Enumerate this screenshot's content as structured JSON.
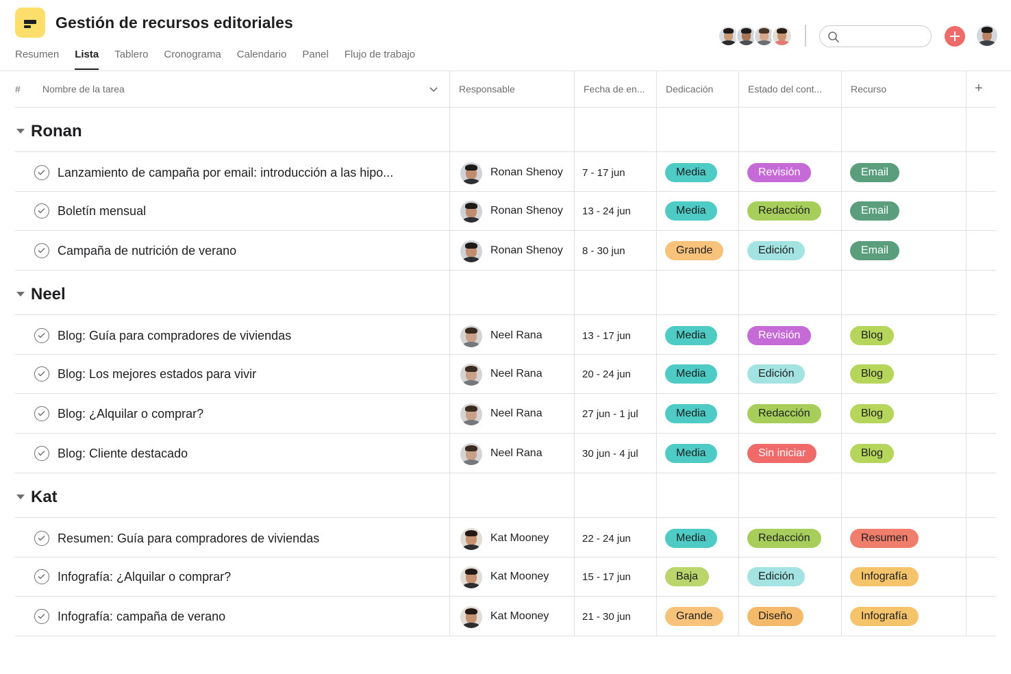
{
  "project": {
    "title": "Gestión de recursos editoriales"
  },
  "tabs": [
    {
      "label": "Resumen",
      "active": false
    },
    {
      "label": "Lista",
      "active": true
    },
    {
      "label": "Tablero",
      "active": false
    },
    {
      "label": "Cronograma",
      "active": false
    },
    {
      "label": "Calendario",
      "active": false
    },
    {
      "label": "Panel",
      "active": false
    },
    {
      "label": "Flujo de trabajo",
      "active": false
    }
  ],
  "columns": {
    "number": "#",
    "task": "Nombre de la tarea",
    "assignee": "Responsable",
    "due": "Fecha de en...",
    "effort": "Dedicación",
    "status": "Estado del cont...",
    "resource": "Recurso",
    "add": "+"
  },
  "colors": {
    "Media": {
      "bg": "#4ecbc4",
      "fg": "#1e1f21"
    },
    "Grande": {
      "bg": "#f8c27a",
      "fg": "#1e1f21"
    },
    "Baja": {
      "bg": "#b9d56b",
      "fg": "#1e1f21"
    },
    "Revisión": {
      "bg": "#c56ad6",
      "fg": "#ffffff"
    },
    "Redacción": {
      "bg": "#a7ce5b",
      "fg": "#1e1f21"
    },
    "Edición": {
      "bg": "#a3e3e1",
      "fg": "#1e1f21"
    },
    "Sin iniciar": {
      "bg": "#f06a6a",
      "fg": "#ffffff"
    },
    "Diseño": {
      "bg": "#f5b96a",
      "fg": "#1e1f21"
    },
    "Email": {
      "bg": "#5a9e7d",
      "fg": "#ffffff"
    },
    "Blog": {
      "bg": "#b5d65a",
      "fg": "#1e1f21"
    },
    "Resumen": {
      "bg": "#ef7e6c",
      "fg": "#1e1f21"
    },
    "Infografía": {
      "bg": "#f5c46a",
      "fg": "#1e1f21"
    },
    "accent": "#f06a6a",
    "logo": "#fcdf6b"
  },
  "sections": [
    {
      "name": "Ronan",
      "tasks": [
        {
          "name": "Lanzamiento de campaña por email: introducción a las hipo...",
          "assignee": "Ronan Shenoy",
          "due": "7 - 17 jun",
          "effort": "Media",
          "status": "Revisión",
          "resource": "Email"
        },
        {
          "name": "Boletín mensual",
          "assignee": "Ronan Shenoy",
          "due": "13 - 24 jun",
          "effort": "Media",
          "status": "Redacción",
          "resource": "Email"
        },
        {
          "name": "Campaña de nutrición de verano",
          "assignee": "Ronan Shenoy",
          "due": "8 - 30 jun",
          "effort": "Grande",
          "status": "Edición",
          "resource": "Email"
        }
      ]
    },
    {
      "name": "Neel",
      "tasks": [
        {
          "name": "Blog: Guía para compradores de viviendas",
          "assignee": "Neel Rana",
          "due": "13 - 17 jun",
          "effort": "Media",
          "status": "Revisión",
          "resource": "Blog"
        },
        {
          "name": "Blog: Los mejores estados para vivir",
          "assignee": "Neel Rana",
          "due": "20 - 24 jun",
          "effort": "Media",
          "status": "Edición",
          "resource": "Blog"
        },
        {
          "name": "Blog: ¿Alquilar o comprar?",
          "assignee": "Neel Rana",
          "due": "27 jun - 1 jul",
          "effort": "Media",
          "status": "Redacción",
          "resource": "Blog"
        },
        {
          "name": "Blog: Cliente destacado",
          "assignee": "Neel Rana",
          "due": "30 jun - 4 jul",
          "effort": "Media",
          "status": "Sin iniciar",
          "resource": "Blog"
        }
      ]
    },
    {
      "name": "Kat",
      "tasks": [
        {
          "name": "Resumen: Guía para compradores de viviendas",
          "assignee": "Kat Mooney",
          "due": "22 - 24 jun",
          "effort": "Media",
          "status": "Redacción",
          "resource": "Resumen"
        },
        {
          "name": "Infografía: ¿Alquilar o comprar?",
          "assignee": "Kat Mooney",
          "due": "15 - 17 jun",
          "effort": "Baja",
          "status": "Edición",
          "resource": "Infografía"
        },
        {
          "name": "Infografía: campaña de verano",
          "assignee": "Kat Mooney",
          "due": "21 - 30 jun",
          "effort": "Grande",
          "status": "Diseño",
          "resource": "Infografía"
        }
      ]
    }
  ]
}
